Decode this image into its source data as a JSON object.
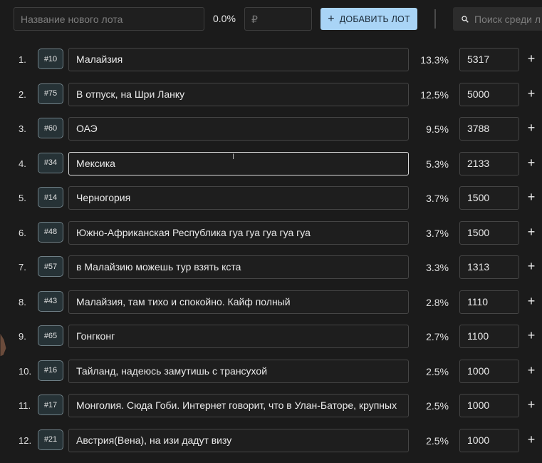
{
  "new_lot": {
    "name_placeholder": "Название нового лота",
    "percent": "0.0%",
    "price_placeholder": "₽",
    "add_button_label": "ДОБАВИТЬ ЛОТ",
    "add_icon": "plus-icon"
  },
  "search": {
    "placeholder": "Поиск среди л",
    "icon": "search-icon"
  },
  "lots": [
    {
      "index": "1.",
      "tag": "#10",
      "name": "Малайзия",
      "percent": "13.3%",
      "amount": "5317"
    },
    {
      "index": "2.",
      "tag": "#75",
      "name": "В отпуск, на Шри Ланку",
      "percent": "12.5%",
      "amount": "5000"
    },
    {
      "index": "3.",
      "tag": "#60",
      "name": "ОАЭ",
      "percent": "9.5%",
      "amount": "3788"
    },
    {
      "index": "4.",
      "tag": "#34",
      "name": "Мексика",
      "percent": "5.3%",
      "amount": "2133"
    },
    {
      "index": "5.",
      "tag": "#14",
      "name": "Черногория",
      "percent": "3.7%",
      "amount": "1500"
    },
    {
      "index": "6.",
      "tag": "#48",
      "name": "Южно-Африканская Республика гуа гуа гуа гуа гуа",
      "percent": "3.7%",
      "amount": "1500"
    },
    {
      "index": "7.",
      "tag": "#57",
      "name": "в Малайзию можешь тур взять кста",
      "percent": "3.3%",
      "amount": "1313"
    },
    {
      "index": "8.",
      "tag": "#43",
      "name": "Малайзия, там тихо и спокойно. Кайф полный",
      "percent": "2.8%",
      "amount": "1110"
    },
    {
      "index": "9.",
      "tag": "#65",
      "name": "Гонгконг",
      "percent": "2.7%",
      "amount": "1100"
    },
    {
      "index": "10.",
      "tag": "#16",
      "name": "Тайланд, надеюсь замутишь с трансухой",
      "percent": "2.5%",
      "amount": "1000"
    },
    {
      "index": "11.",
      "tag": "#17",
      "name": "Монголия. Сюда Гоби. Интернет говорит, что в Улан-Баторе, крупных",
      "percent": "2.5%",
      "amount": "1000"
    },
    {
      "index": "12.",
      "tag": "#21",
      "name": "Австрия(Вена), на изи дадут визу",
      "percent": "2.5%",
      "amount": "1000"
    }
  ],
  "row_plus_label": "+",
  "focused_row": 4,
  "colors": {
    "background": "#1b1b1b",
    "accent_button": "#a9d4f6",
    "tag_background": "#263236"
  }
}
